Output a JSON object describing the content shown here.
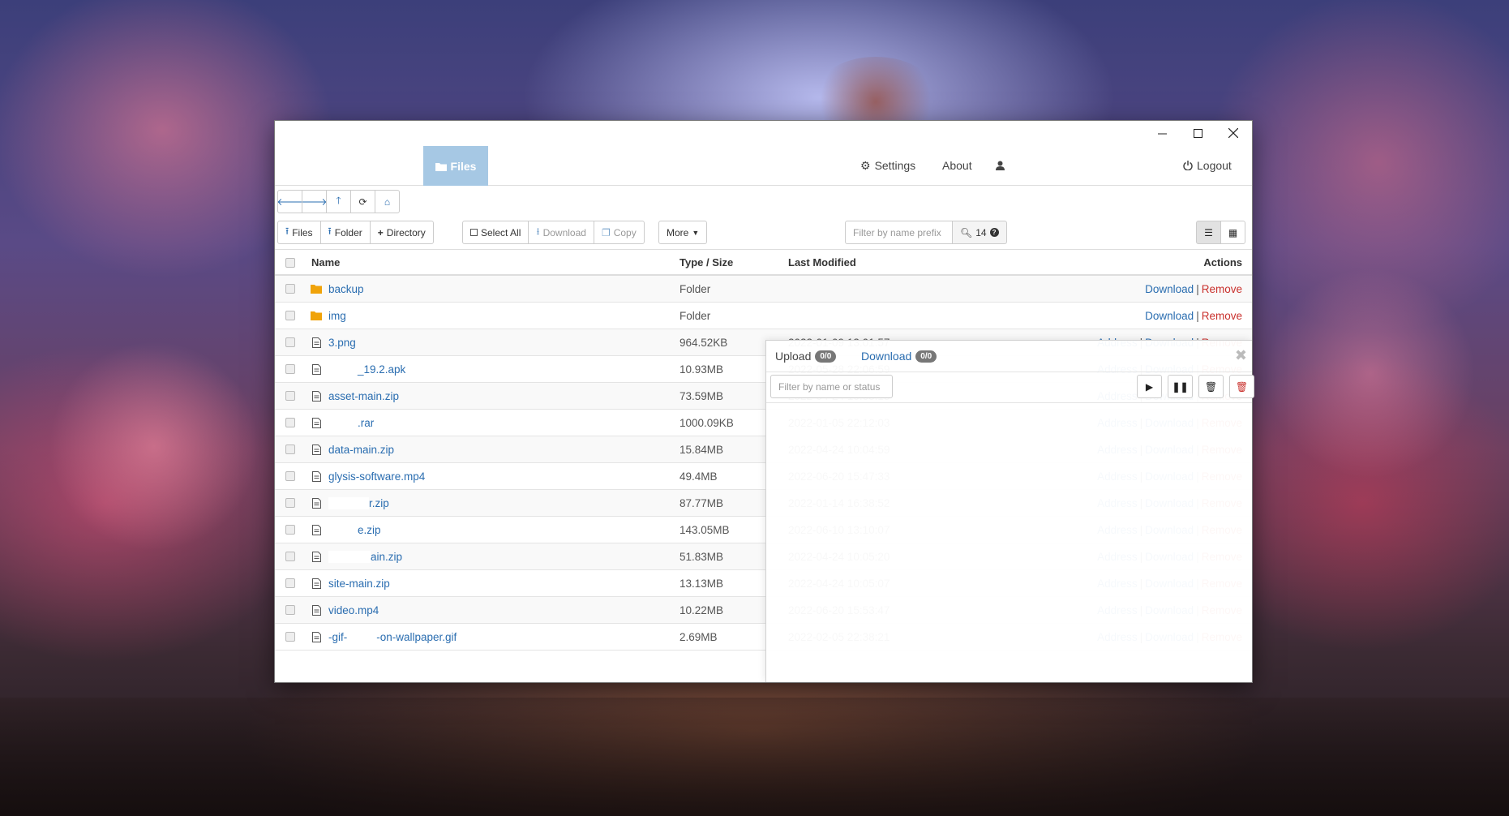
{
  "window": {
    "minimize_icon": "minimize-icon",
    "maximize_icon": "maximize-icon",
    "close_icon": "close-icon"
  },
  "navbar": {
    "files_label": "Files",
    "settings_label": "Settings",
    "about_label": "About",
    "logout_label": "Logout",
    "active_color": "#a6c8e4"
  },
  "toolbar": {
    "upload_files": "Files",
    "upload_folder": "Folder",
    "new_directory": "Directory",
    "select_all": "Select All",
    "download": "Download",
    "copy": "Copy",
    "more": "More",
    "filter_placeholder": "Filter by name prefix",
    "result_count": "14"
  },
  "table": {
    "headers": {
      "name": "Name",
      "type_size": "Type / Size",
      "last_modified": "Last Modified",
      "actions": "Actions"
    },
    "action_download": "Download",
    "action_remove": "Remove",
    "action_address": "Address",
    "rows": [
      {
        "name": "backup",
        "type": "Folder",
        "modified": "",
        "icon": "folder-icon"
      },
      {
        "name": "img",
        "type": "Folder",
        "modified": "",
        "icon": "folder-icon"
      },
      {
        "name": "3.png",
        "type": "964.52KB",
        "modified": "2022-01-09 13:01:57",
        "icon": "image-file-icon"
      },
      {
        "name": "_19.2.apk",
        "type": "10.93MB",
        "modified": "2022-05-28 22:06:59",
        "icon": "android-icon"
      },
      {
        "name": "asset-main.zip",
        "type": "73.59MB",
        "modified": "2022-04-24 10:05:13",
        "icon": "archive-file-icon"
      },
      {
        "name": ".rar",
        "type": "1000.09KB",
        "modified": "2022-01-05 22:12:03",
        "icon": "file-icon"
      },
      {
        "name": "data-main.zip",
        "type": "15.84MB",
        "modified": "2022-04-24 10:04:59",
        "icon": "archive-file-icon"
      },
      {
        "name": "glysis-software.mp4",
        "type": "49.4MB",
        "modified": "2022-06-20 15:47:33",
        "icon": "video-file-icon"
      },
      {
        "name": "r.zip",
        "type": "87.77MB",
        "modified": "2022-01-14 16:38:52",
        "icon": "archive-file-icon"
      },
      {
        "name": "e.zip",
        "type": "143.05MB",
        "modified": "2022-06-10 13:10:07",
        "icon": "archive-file-icon"
      },
      {
        "name": "ain.zip",
        "type": "51.83MB",
        "modified": "2022-04-24 10:05:20",
        "icon": "archive-file-icon"
      },
      {
        "name": "site-main.zip",
        "type": "13.13MB",
        "modified": "2022-04-24 10:05:07",
        "icon": "archive-file-icon"
      },
      {
        "name": "video.mp4",
        "type": "10.22MB",
        "modified": "2022-06-20 15:53:47",
        "icon": "video-file-icon"
      },
      {
        "name": "-gif-",
        "name2": "-on-wallpaper.gif",
        "type": "2.69MB",
        "modified": "2022-02-05 22:38:21",
        "icon": "image-file-icon"
      }
    ]
  },
  "transfer_panel": {
    "upload_tab": "Upload",
    "upload_badge": "0/0",
    "download_tab": "Download",
    "download_badge": "0/0",
    "filter_placeholder": "Filter by name or status"
  }
}
